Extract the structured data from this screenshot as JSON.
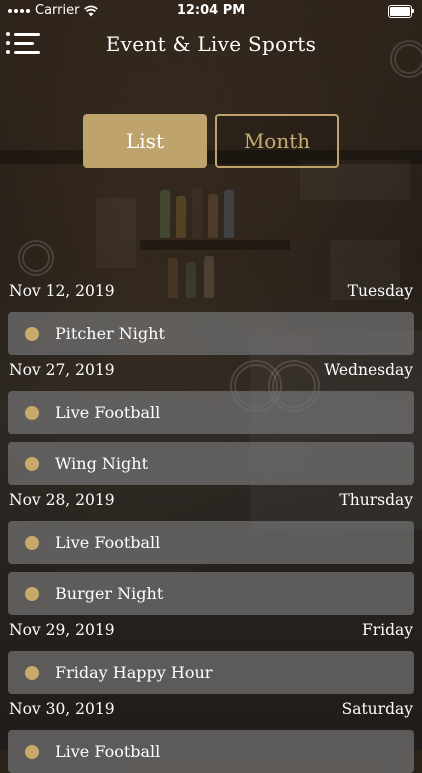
{
  "status": {
    "carrier": "Carrier",
    "time": "12:04 PM"
  },
  "header": {
    "title": "Event & Live Sports",
    "menu_icon": "menu-icon"
  },
  "tabs": [
    {
      "label": "List",
      "active": true
    },
    {
      "label": "Month",
      "active": false
    }
  ],
  "colors": {
    "accent": "#bea46c",
    "card": "#737373"
  },
  "days": [
    {
      "date": "Nov 12, 2019",
      "weekday": "Tuesday",
      "events": [
        "Pitcher Night"
      ]
    },
    {
      "date": "Nov 27, 2019",
      "weekday": "Wednesday",
      "events": [
        "Live Football",
        "Wing Night"
      ]
    },
    {
      "date": "Nov 28, 2019",
      "weekday": "Thursday",
      "events": [
        "Live Football",
        "Burger Night"
      ]
    },
    {
      "date": "Nov 29, 2019",
      "weekday": "Friday",
      "events": [
        "Friday Happy Hour"
      ]
    },
    {
      "date": "Nov 30, 2019",
      "weekday": "Saturday",
      "events": [
        "Live Football"
      ]
    }
  ]
}
